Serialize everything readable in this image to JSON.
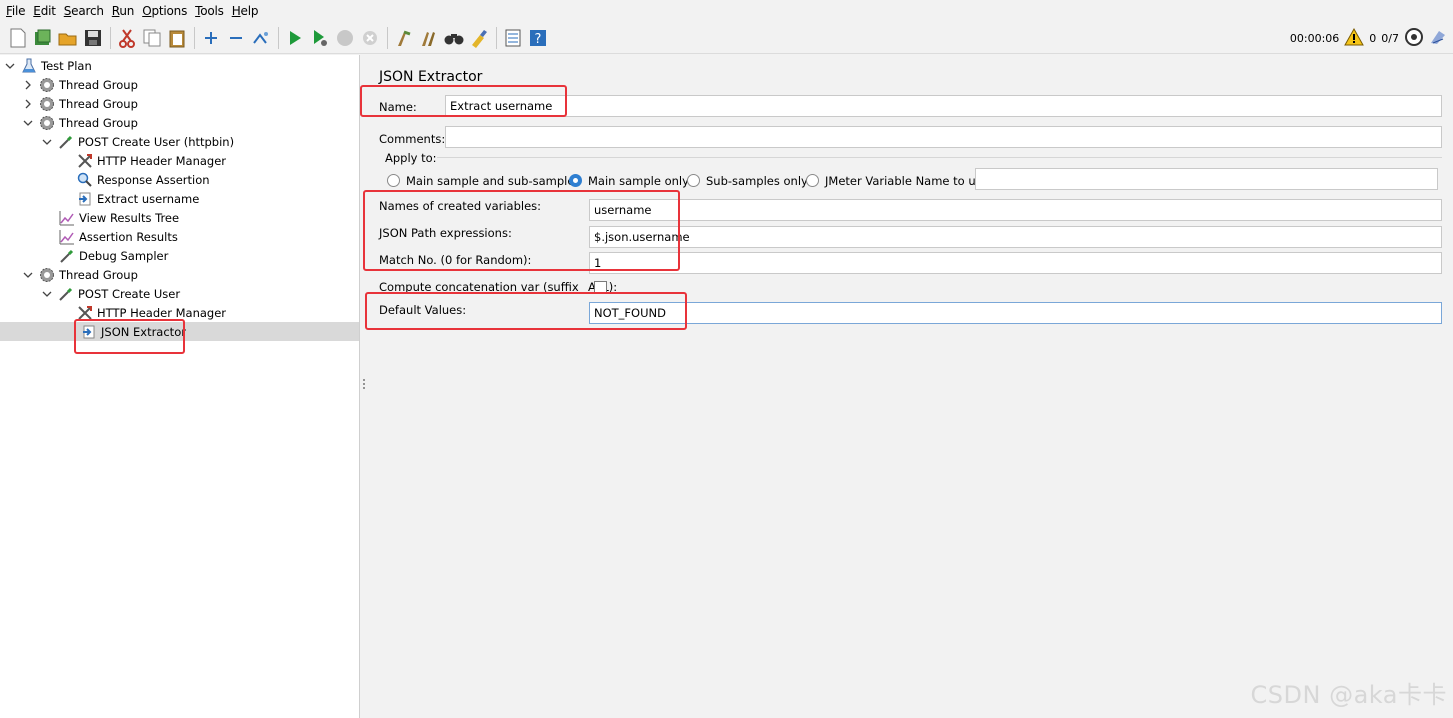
{
  "menu": [
    "File",
    "Edit",
    "Search",
    "Run",
    "Options",
    "Tools",
    "Help"
  ],
  "menu_mnemonics": [
    "F",
    "E",
    "S",
    "R",
    "O",
    "T",
    "H"
  ],
  "toolbar": {
    "timer": "00:00:06",
    "warning_count": "0",
    "threads": "0/7"
  },
  "tree": {
    "items": [
      {
        "label": "Test Plan",
        "icon": "test-plan-icon"
      },
      {
        "label": "Thread Group",
        "icon": "gear-icon"
      },
      {
        "label": "Thread Group",
        "icon": "gear-icon"
      },
      {
        "label": "Thread Group",
        "icon": "gear-icon"
      },
      {
        "label": "POST Create User (httpbin)",
        "icon": "pipette-icon"
      },
      {
        "label": "HTTP Header Manager",
        "icon": "tools-icon"
      },
      {
        "label": "Response Assertion",
        "icon": "magnifier-icon"
      },
      {
        "label": "Extract username",
        "icon": "extractor-icon"
      },
      {
        "label": "View Results Tree",
        "icon": "graph-icon"
      },
      {
        "label": "Assertion Results",
        "icon": "graph-icon"
      },
      {
        "label": "Debug Sampler",
        "icon": "pipette-icon"
      },
      {
        "label": "Thread Group",
        "icon": "gear-icon"
      },
      {
        "label": "POST Create User",
        "icon": "pipette-icon"
      },
      {
        "label": "HTTP Header Manager",
        "icon": "tools-icon"
      },
      {
        "label": "JSON Extractor",
        "icon": "extractor-icon"
      }
    ]
  },
  "form": {
    "title": "JSON Extractor",
    "name_label": "Name:",
    "name_value": "Extract username",
    "comments_label": "Comments:",
    "comments_value": "",
    "apply_to_label": "Apply to:",
    "apply_options": [
      "Main sample and sub-samples",
      "Main sample only",
      "Sub-samples only",
      "JMeter Variable Name to use"
    ],
    "apply_selected": "Main sample only",
    "jmeter_var_value": "",
    "vars_label": "Names of created variables:",
    "vars_value": "username",
    "path_label": "JSON Path expressions:",
    "path_value": "$.json.username",
    "match_label": "Match No. (0 for Random):",
    "match_value": "1",
    "concat_label": "Compute concatenation var (suffix _ALL):",
    "default_label": "Default Values:",
    "default_value": "NOT_FOUND"
  },
  "watermark": "CSDN @aka卡卡",
  "colors": {
    "highlight": "#e8333a",
    "selection": "#d9d9d9",
    "radio_on": "#2f7fd1"
  }
}
